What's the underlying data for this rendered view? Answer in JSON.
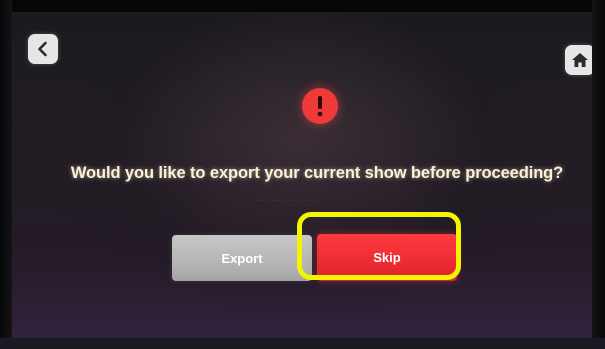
{
  "dialog": {
    "question": "Would you like to export your current show before proceeding?",
    "faint_text_1": "···· ·· ·······    ·····  ··· ·····  ···",
    "faint_text_2": "···· ·"
  },
  "buttons": {
    "export_label": "Export",
    "skip_label": "Skip"
  },
  "icons": {
    "back": "chevron-left-icon",
    "home": "home-icon",
    "alert": "exclamation-icon"
  },
  "colors": {
    "alert_red": "#ef3a3a",
    "skip_red": "#ff3a3f",
    "export_gray": "#b8b8b8",
    "highlight_yellow": "#f2f500",
    "question_text": "#fbf3d8"
  }
}
